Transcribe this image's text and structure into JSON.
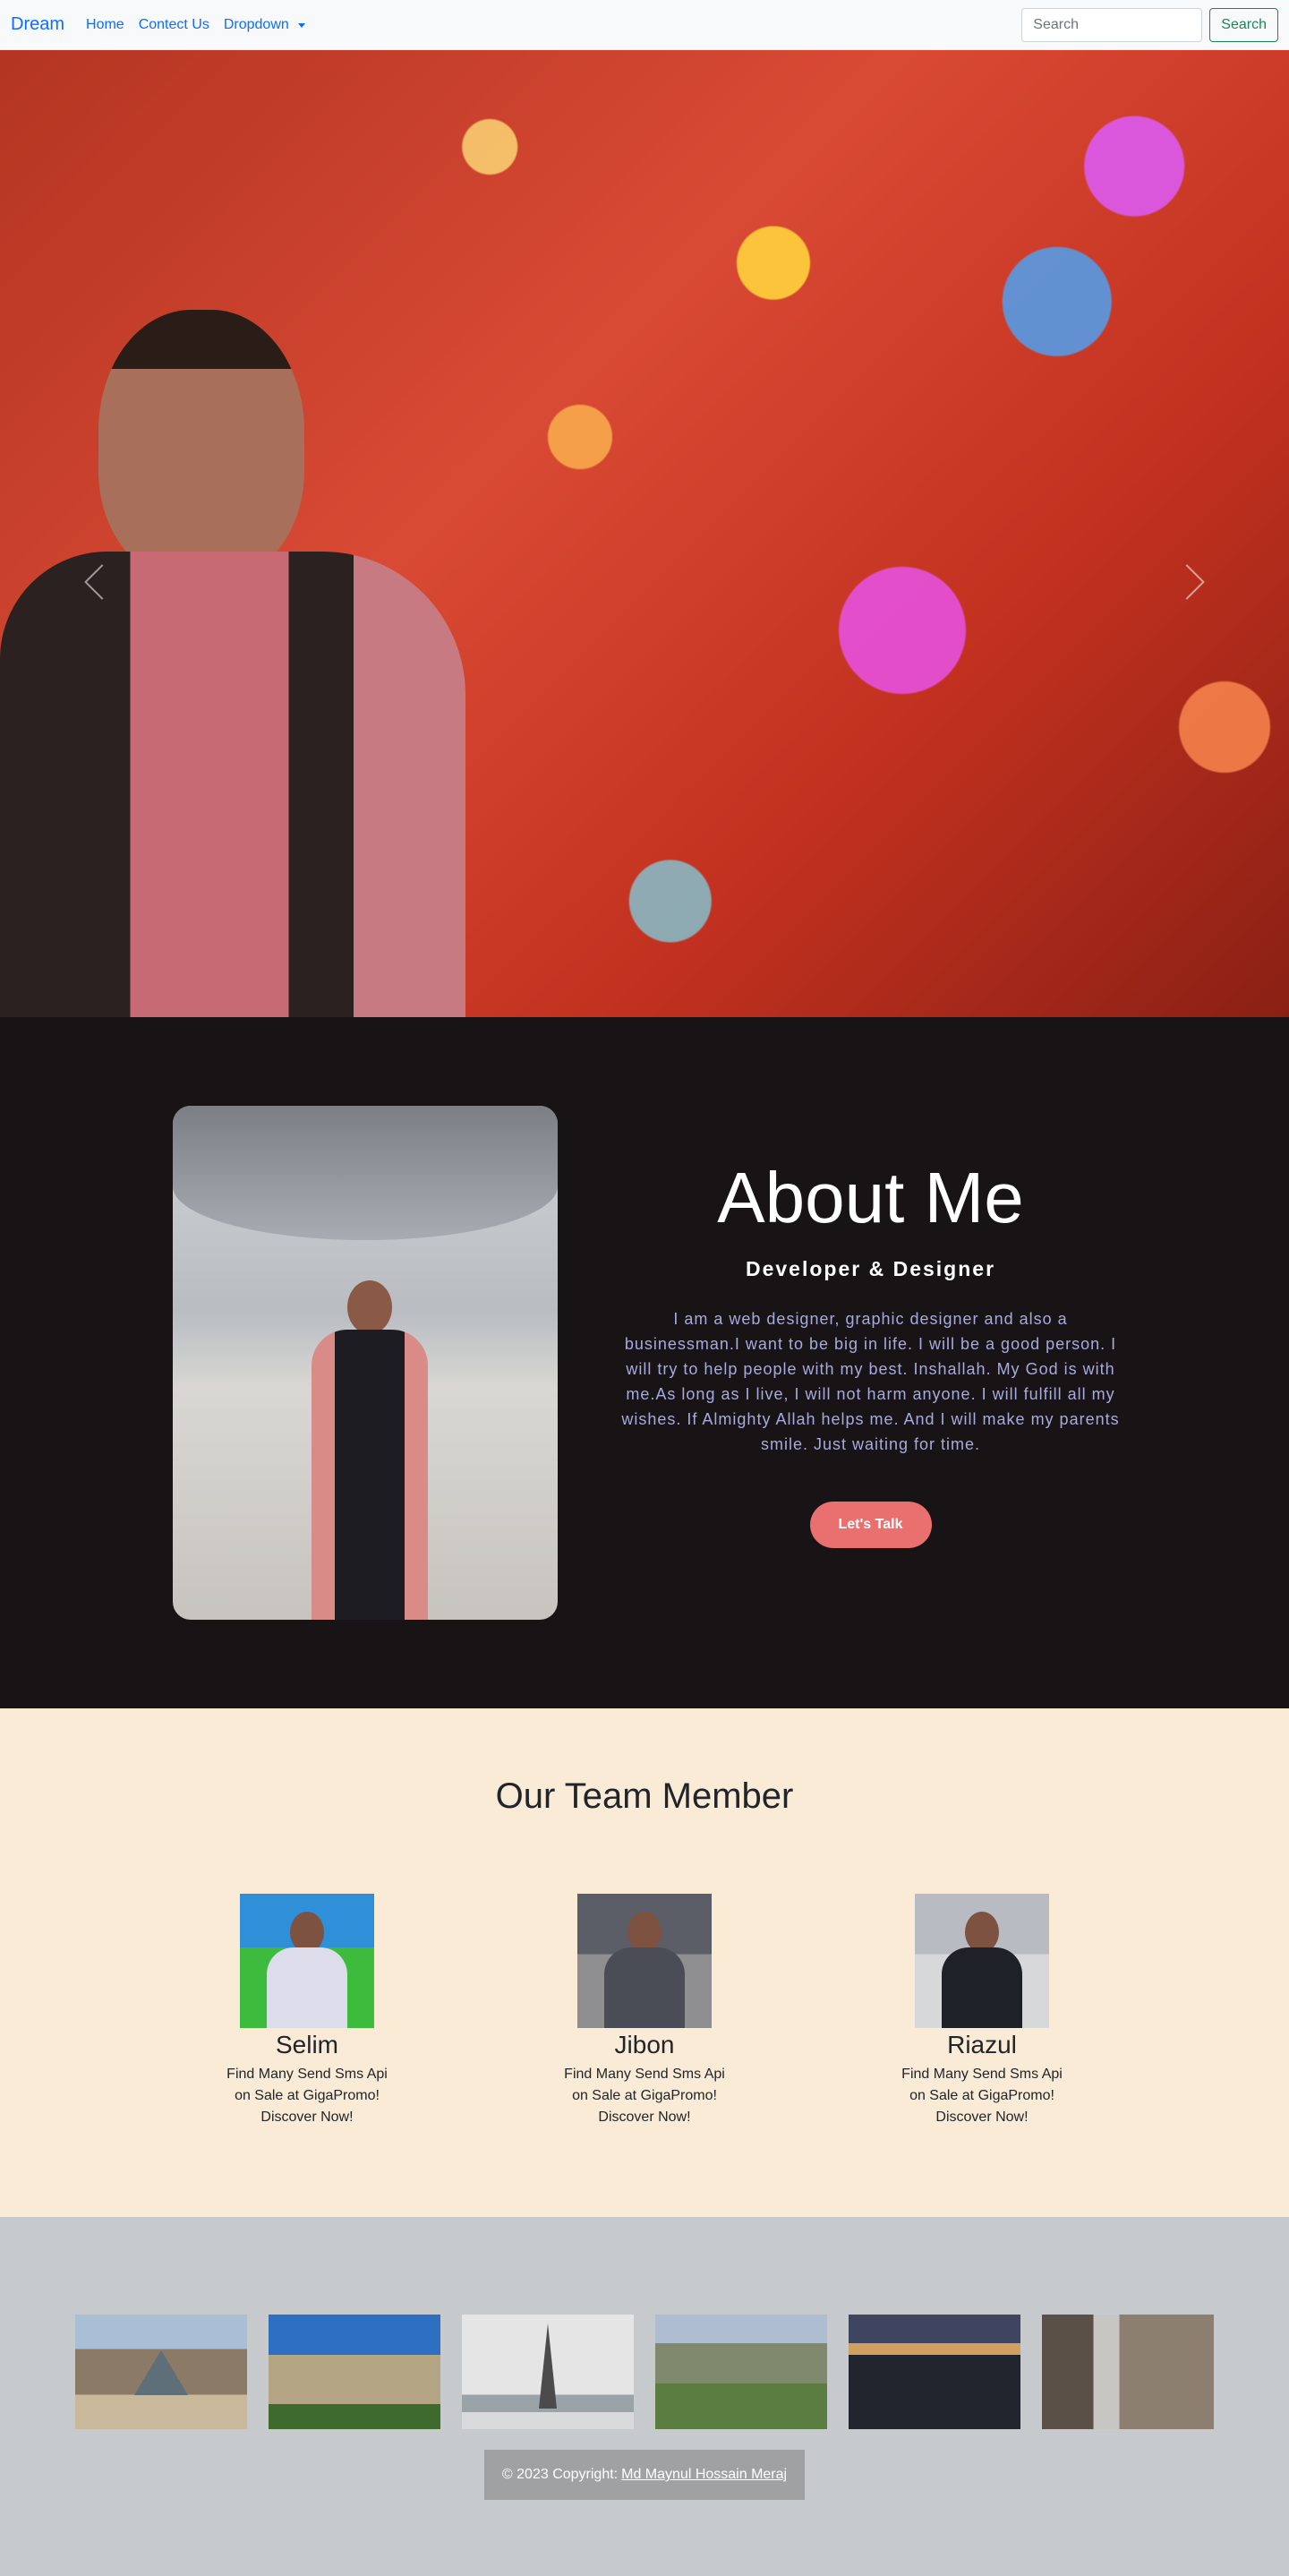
{
  "navbar": {
    "brand": "Dream",
    "links": [
      {
        "label": "Home"
      },
      {
        "label": "Contect Us"
      },
      {
        "label": "Dropdown"
      }
    ],
    "search_placeholder": "Search",
    "search_button": "Search"
  },
  "hero": {
    "prev_icon": "chevron-left-icon",
    "next_icon": "chevron-right-icon"
  },
  "about": {
    "title": "About Me",
    "subtitle": "Developer & Designer",
    "description": "I am a web designer, graphic designer and also a businessman.I want to be big in life. I will be a good person. I will try to help people with my best. Inshallah. My God is with me.As long as I live, I will not harm anyone. I will fulfill all my wishes. If Almighty Allah helps me. And I will make my parents smile. Just waiting for time.",
    "button": "Let's Talk",
    "accent_color": "#e9706f"
  },
  "team": {
    "title": "Our Team Member",
    "members": [
      {
        "name": "Selim",
        "desc": "Find Many Send Sms Api on Sale at GigaPromo! Discover Now!"
      },
      {
        "name": "Jibon",
        "desc": "Find Many Send Sms Api on Sale at GigaPromo! Discover Now!"
      },
      {
        "name": "Riazul",
        "desc": "Find Many Send Sms Api on Sale at GigaPromo! Discover Now!"
      }
    ]
  },
  "footer": {
    "copyright_prefix": "© 2023 Copyright:",
    "copyright_link": "Md Maynul Hossain Meraj"
  },
  "colors": {
    "nav_bg": "#f8f9fa",
    "link": "#0d6efd",
    "search_green": "#198754",
    "about_bg": "#181415",
    "team_bg": "#faebd6",
    "footer_bg": "#c7cacd"
  }
}
